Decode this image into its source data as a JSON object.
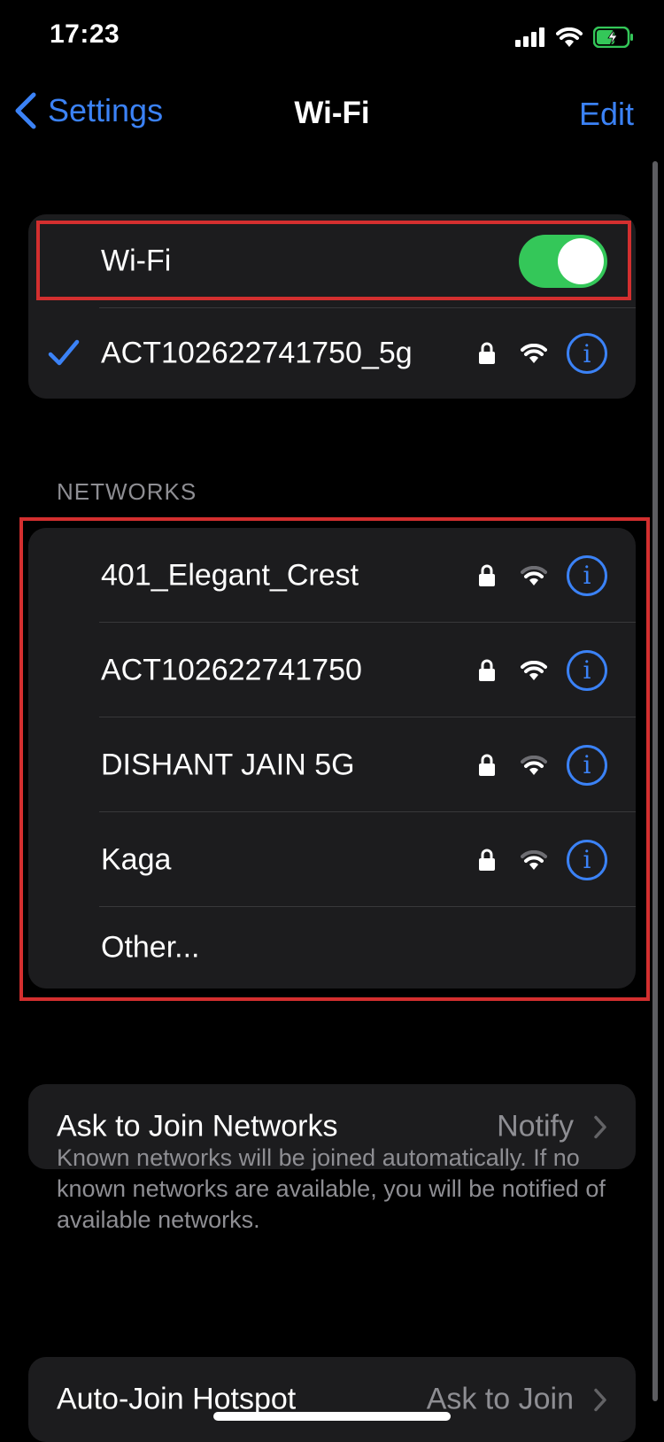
{
  "status_bar": {
    "time": "17:23"
  },
  "nav": {
    "back_label": "Settings",
    "title": "Wi-Fi",
    "edit_label": "Edit"
  },
  "wifi_toggle": {
    "label": "Wi-Fi",
    "on": true
  },
  "connected_network": {
    "name": "ACT102622741750_5g",
    "secured": true
  },
  "networks": {
    "header": "NETWORKS",
    "items": [
      {
        "name": "401_Elegant_Crest"
      },
      {
        "name": "ACT102622741750"
      },
      {
        "name": "DISHANT JAIN 5G"
      },
      {
        "name": "Kaga"
      }
    ],
    "other_label": "Other..."
  },
  "ask_to_join": {
    "label": "Ask to Join Networks",
    "value": "Notify",
    "footer": "Known networks will be joined automatically. If no known networks are available, you will be notified of available networks."
  },
  "auto_join_hotspot": {
    "label": "Auto-Join Hotspot",
    "value": "Ask to Join"
  },
  "colors": {
    "accent": "#3b82f6",
    "toggle_on": "#34c759",
    "highlight_box": "#d32f2f",
    "battery_charging": "#34c759"
  },
  "icons": [
    "signal-bars-icon",
    "wifi-icon",
    "battery-charging-icon",
    "chevron-left-icon",
    "checkmark-icon",
    "lock-icon",
    "info-icon",
    "chevron-right-icon"
  ]
}
